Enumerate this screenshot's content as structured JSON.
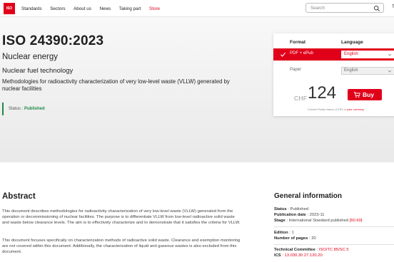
{
  "nav": {
    "logo_text": "ISO",
    "items": [
      "Standards",
      "Sectors",
      "About us",
      "News",
      "Taking part"
    ],
    "store": "Store",
    "search_placeholder": "Search",
    "lang_partial": "T"
  },
  "hero": {
    "title": "ISO 24390:2023",
    "subject": "Nuclear energy",
    "subsubject": "Nuclear fuel technology",
    "description": "Methodologies for radioactivity characterization of very low-level waste (VLLW) generated by nuclear facilities",
    "status_label": "Status : ",
    "status_value": "Published"
  },
  "buy": {
    "format_header": "Format",
    "language_header": "Language",
    "formats": [
      {
        "label": "PDF + ePub",
        "language": "English",
        "selected": true
      },
      {
        "label": "Paper",
        "language": "English",
        "selected": false
      }
    ],
    "currency": "CHF",
    "price": "124",
    "buy_label": "Buy",
    "convert_text": "Convert Swiss francs (CHF) to ",
    "convert_link": "your currency"
  },
  "abstract": {
    "title": "Abstract",
    "p1": "This document describes methodologies for radioactivity characterization of very low-level waste (VLLW) generated from the operation or decommissioning of nuclear facilities. The purpose is to differentiate VLLW from low-level radioactive solid waste and waste below clearance levels. The aim is to effectively characterize and to demonstrate that it satisfies the criteria for VLLW.",
    "p2": "This document focuses specifically on characterization methods of radioactive solid waste. Clearance and exemption monitoring are not covered within this document. Additionally, the characterization of liquid and gaseous wastes is also excluded from this document."
  },
  "general": {
    "title": "General information",
    "status_label": "Status",
    "status_value": " : Published",
    "pubdate_label": "Publication date",
    "pubdate_value": " : 2023-11",
    "stage_label": "Stage",
    "stage_value": " : International Standard published ",
    "stage_code": "[60.60]",
    "edition_label": "Edition",
    "edition_value": " : 1",
    "pages_label": "Number of pages",
    "pages_value": " : 20",
    "tc_label": "Technical Committee",
    "tc_sep": " : ",
    "tc_value": "ISO/TC 85/SC 5",
    "ics_label": "ICS",
    "ics_sep": " : ",
    "ics_value": "13.030.30  27.120.20"
  },
  "colors": {
    "accent": "#e1001a",
    "status_green": "#1e8a48"
  },
  "icons": {
    "search": "search-icon",
    "check": "check-icon",
    "chevron": "chevron-down-icon",
    "cart": "cart-icon"
  }
}
